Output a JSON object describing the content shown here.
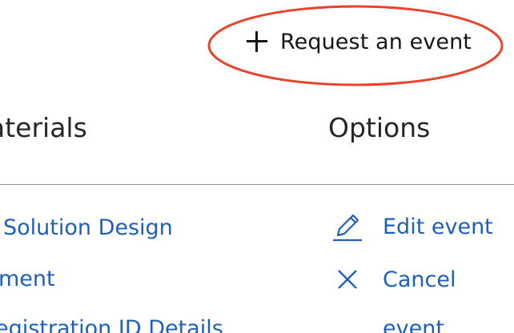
{
  "toolbar": {
    "request_label": "Request an event"
  },
  "table": {
    "headers": {
      "materials": "aterials",
      "options": "Options"
    },
    "materials": [
      "Solution Design",
      "ment",
      "egistration ID Details"
    ],
    "options": {
      "edit_label": "Edit event",
      "cancel_label": "Cancel",
      "cancel_label_cont": "event"
    }
  },
  "icons": {
    "plus": "plus-icon",
    "pencil": "pencil-icon",
    "close": "close-icon"
  },
  "colors": {
    "link": "#1f5fb8",
    "text": "#161616",
    "annotation": "#e8432d",
    "divider": "#8d8d8d"
  }
}
